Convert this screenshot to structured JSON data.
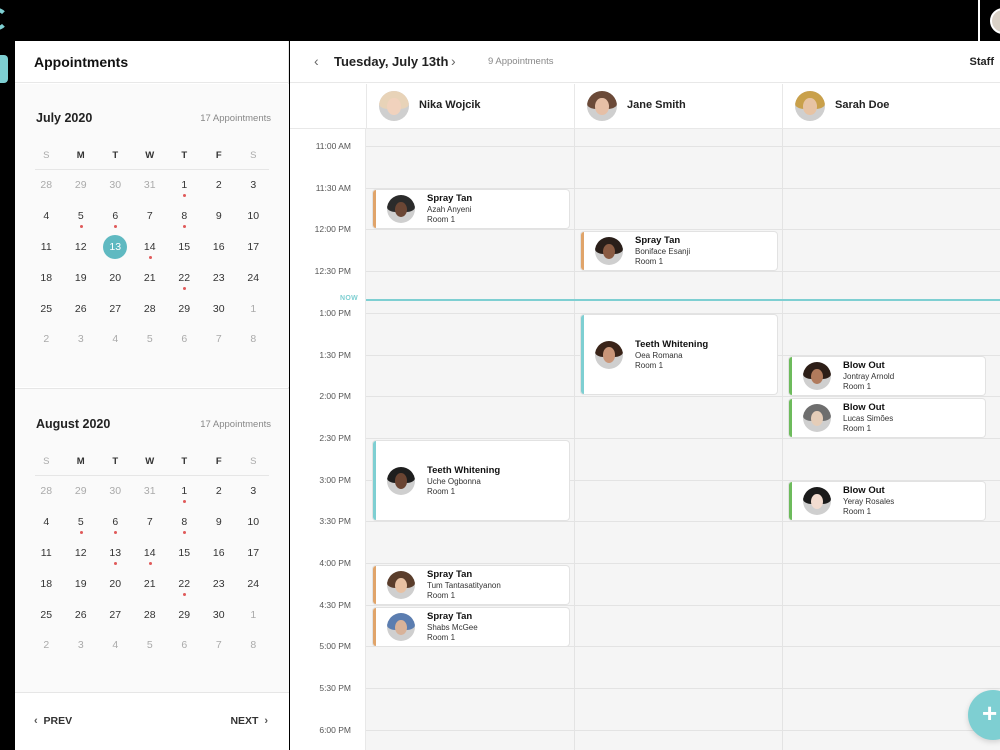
{
  "sidebar": {
    "title": "Appointments",
    "months": [
      {
        "title": "July 2020",
        "count": "17 Appointments",
        "dow": [
          "S",
          "M",
          "T",
          "W",
          "T",
          "F",
          "S"
        ],
        "weeks": [
          [
            {
              "d": "28",
              "m": true
            },
            {
              "d": "29",
              "m": true
            },
            {
              "d": "30",
              "m": true
            },
            {
              "d": "31",
              "m": true
            },
            {
              "d": "1",
              "dot": true
            },
            {
              "d": "2"
            },
            {
              "d": "3"
            }
          ],
          [
            {
              "d": "4"
            },
            {
              "d": "5",
              "dot": true
            },
            {
              "d": "6",
              "dot": true
            },
            {
              "d": "7"
            },
            {
              "d": "8",
              "dot": true
            },
            {
              "d": "9"
            },
            {
              "d": "10"
            }
          ],
          [
            {
              "d": "11"
            },
            {
              "d": "12"
            },
            {
              "d": "13",
              "sel": true
            },
            {
              "d": "14",
              "dot": true
            },
            {
              "d": "15"
            },
            {
              "d": "16"
            },
            {
              "d": "17"
            }
          ],
          [
            {
              "d": "18"
            },
            {
              "d": "19"
            },
            {
              "d": "20"
            },
            {
              "d": "21"
            },
            {
              "d": "22",
              "dot": true
            },
            {
              "d": "23"
            },
            {
              "d": "24"
            }
          ],
          [
            {
              "d": "25"
            },
            {
              "d": "26"
            },
            {
              "d": "27"
            },
            {
              "d": "28"
            },
            {
              "d": "29"
            },
            {
              "d": "30"
            },
            {
              "d": "1",
              "m": true
            }
          ],
          [
            {
              "d": "2",
              "m": true
            },
            {
              "d": "3",
              "m": true
            },
            {
              "d": "4",
              "m": true
            },
            {
              "d": "5",
              "m": true
            },
            {
              "d": "6",
              "m": true
            },
            {
              "d": "7",
              "m": true
            },
            {
              "d": "8",
              "m": true
            }
          ]
        ]
      },
      {
        "title": "August 2020",
        "count": "17 Appointments",
        "dow": [
          "S",
          "M",
          "T",
          "W",
          "T",
          "F",
          "S"
        ],
        "weeks": [
          [
            {
              "d": "28",
              "m": true
            },
            {
              "d": "29",
              "m": true
            },
            {
              "d": "30",
              "m": true
            },
            {
              "d": "31",
              "m": true
            },
            {
              "d": "1",
              "dot": true
            },
            {
              "d": "2"
            },
            {
              "d": "3"
            }
          ],
          [
            {
              "d": "4"
            },
            {
              "d": "5",
              "dot": true
            },
            {
              "d": "6",
              "dot": true
            },
            {
              "d": "7"
            },
            {
              "d": "8",
              "dot": true
            },
            {
              "d": "9"
            },
            {
              "d": "10"
            }
          ],
          [
            {
              "d": "11"
            },
            {
              "d": "12"
            },
            {
              "d": "13",
              "dot": true
            },
            {
              "d": "14",
              "dot": true
            },
            {
              "d": "15"
            },
            {
              "d": "16"
            },
            {
              "d": "17"
            }
          ],
          [
            {
              "d": "18"
            },
            {
              "d": "19"
            },
            {
              "d": "20"
            },
            {
              "d": "21"
            },
            {
              "d": "22",
              "dot": true
            },
            {
              "d": "23"
            },
            {
              "d": "24"
            }
          ],
          [
            {
              "d": "25"
            },
            {
              "d": "26"
            },
            {
              "d": "27"
            },
            {
              "d": "28"
            },
            {
              "d": "29"
            },
            {
              "d": "30"
            },
            {
              "d": "1",
              "m": true
            }
          ],
          [
            {
              "d": "2",
              "m": true
            },
            {
              "d": "3",
              "m": true
            },
            {
              "d": "4",
              "m": true
            },
            {
              "d": "5",
              "m": true
            },
            {
              "d": "6",
              "m": true
            },
            {
              "d": "7",
              "m": true
            },
            {
              "d": "8",
              "m": true
            }
          ]
        ]
      }
    ],
    "prev_label": "PREV",
    "next_label": "NEXT"
  },
  "header": {
    "date": "Tuesday, July 13th",
    "count": "9 Appointments",
    "staff_label": "Staff"
  },
  "staff": [
    {
      "name": "Nika Wojcik",
      "avatar": {
        "hair": "#e8d3b8",
        "skin": "#f1d2bd"
      }
    },
    {
      "name": "Jane Smith",
      "avatar": {
        "hair": "#6b4a38",
        "skin": "#e6bfa6"
      }
    },
    {
      "name": "Sarah Doe",
      "avatar": {
        "hair": "#c9a04a",
        "skin": "#e7c3a3"
      }
    }
  ],
  "times": [
    "11:00 AM",
    "11:30 AM",
    "12:00 PM",
    "12:30 PM",
    "1:00 PM",
    "1:30 PM",
    "2:00 PM",
    "2:30 PM",
    "3:00 PM",
    "3:30 PM",
    "4:00 PM",
    "4:30 PM",
    "5:00 PM",
    "5:30 PM",
    "6:00 PM"
  ],
  "now_label": "NOW",
  "colors": {
    "accent": "#7ecfd2",
    "spray_tan": "#e0a46a",
    "teeth": "#7ecfd2",
    "blow_out": "#6dbb5c",
    "dot": "#e05a5a"
  },
  "appointments": [
    {
      "col": 0,
      "service": "Spray Tan",
      "client": "Azah Anyeni",
      "room": "Room 1",
      "color": "#e0a46a",
      "avatar": {
        "hair": "#2b2b2b",
        "skin": "#6b4634"
      }
    },
    {
      "col": 1,
      "service": "Spray Tan",
      "client": "Boniface Esanji",
      "room": "Room 1",
      "color": "#e0a46a",
      "avatar": {
        "hair": "#2a1f1a",
        "skin": "#8a5b43"
      }
    },
    {
      "col": 1,
      "service": "Teeth Whitening",
      "client": "Oea Romana",
      "room": "Room 1",
      "color": "#7ecfd2",
      "avatar": {
        "hair": "#3a2419",
        "skin": "#c99578"
      }
    },
    {
      "col": 2,
      "service": "Blow Out",
      "client": "Jontray Arnold",
      "room": "Room 1",
      "color": "#6dbb5c",
      "avatar": {
        "hair": "#2d1e17",
        "skin": "#b07a5c"
      }
    },
    {
      "col": 2,
      "service": "Blow Out",
      "client": "Lucas Simões",
      "room": "Room 1",
      "color": "#6dbb5c",
      "avatar": {
        "hair": "#6e6e6e",
        "skin": "#e5cdb8"
      }
    },
    {
      "col": 0,
      "service": "Teeth Whitening",
      "client": "Uche Ogbonna",
      "room": "Room 1",
      "color": "#7ecfd2",
      "avatar": {
        "hair": "#1e1e1e",
        "skin": "#6a4432"
      }
    },
    {
      "col": 2,
      "service": "Blow Out",
      "client": "Yeray Rosales",
      "room": "Room 1",
      "color": "#6dbb5c",
      "avatar": {
        "hair": "#1b1b1b",
        "skin": "#f2dcd0"
      }
    },
    {
      "col": 0,
      "service": "Spray Tan",
      "client": "Tum Tantasatityanon",
      "room": "Room 1",
      "color": "#e0a46a",
      "avatar": {
        "hair": "#5a3d2b",
        "skin": "#e7c1a3"
      }
    },
    {
      "col": 0,
      "service": "Spray Tan",
      "client": "Shabs McGee",
      "room": "Room 1",
      "color": "#e0a46a",
      "avatar": {
        "hair": "#5b7db0",
        "skin": "#d8b299"
      }
    }
  ],
  "fab_label": "+"
}
